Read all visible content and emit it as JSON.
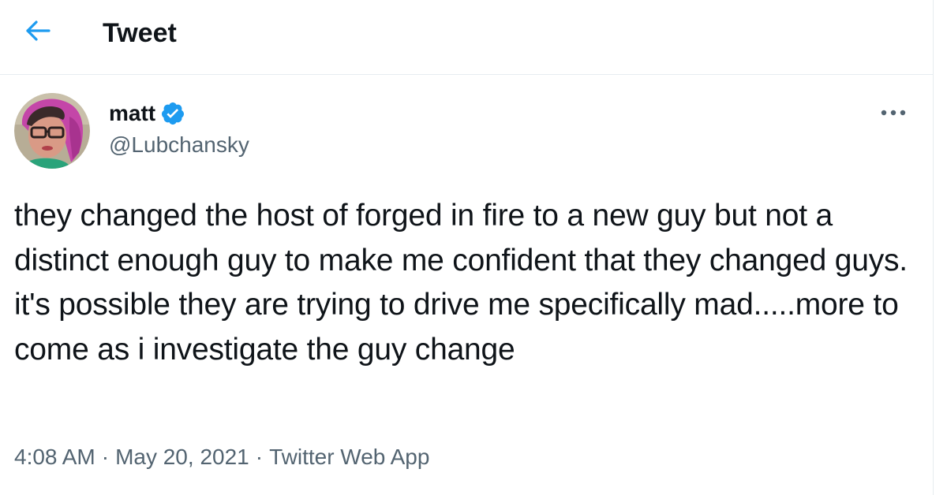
{
  "header": {
    "back_icon": "arrow-left-icon",
    "title": "Tweet"
  },
  "tweet": {
    "author": {
      "display_name": "matt",
      "verified_icon": "verified-badge-icon",
      "handle": "@Lubchansky"
    },
    "more_icon": "more-dots-icon",
    "text": "they changed the host of forged in fire to a new guy but not a distinct enough guy to make me confident that they changed guys. it's possible they are trying to drive me specifically mad.....more to come as i investigate the guy change",
    "time": "4:08 AM",
    "separator_1": "·",
    "date": "May 20, 2021",
    "separator_2": "·",
    "source": "Twitter Web App"
  },
  "colors": {
    "accent": "#1d9bf0",
    "text_primary": "#0f1419",
    "text_secondary": "#536471",
    "divider": "#e6ecf0"
  }
}
